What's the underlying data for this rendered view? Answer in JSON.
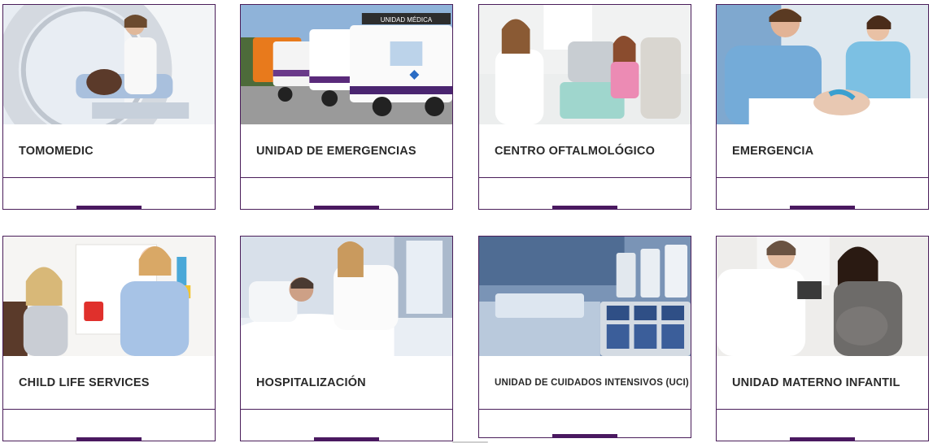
{
  "services": [
    {
      "name": "TOMOMEDIC",
      "image": "ct-scanner-photo",
      "icon": "ct-scanner-icon"
    },
    {
      "name": "UNIDAD DE EMERGENCIAS",
      "image": "ambulances-photo",
      "icon": "ambulance-icon"
    },
    {
      "name": "CENTRO OFTALMOLÓGICO",
      "image": "eye-exam-photo",
      "icon": "eye-exam-icon"
    },
    {
      "name": "EMERGENCIA",
      "image": "emergency-care-photo",
      "icon": "emergency-icon"
    },
    {
      "name": "CHILD LIFE SERVICES",
      "image": "child-play-photo",
      "icon": "child-icon"
    },
    {
      "name": "HOSPITALIZACIÓN",
      "image": "hospital-bed-photo",
      "icon": "hospital-bed-icon"
    },
    {
      "name": "UNIDAD DE CUIDADOS INTENSIVOS (UCI)",
      "image": "icu-monitors-photo",
      "icon": "icu-monitor-icon"
    },
    {
      "name": "UNIDAD MATERNO INFANTIL",
      "image": "maternity-photo",
      "icon": "maternity-icon"
    }
  ],
  "ambulance_text": "UNIDAD MÉDICA",
  "colors": {
    "accent": "#4a1960",
    "border": "#4a1e5a",
    "title": "#2a2a2a"
  }
}
